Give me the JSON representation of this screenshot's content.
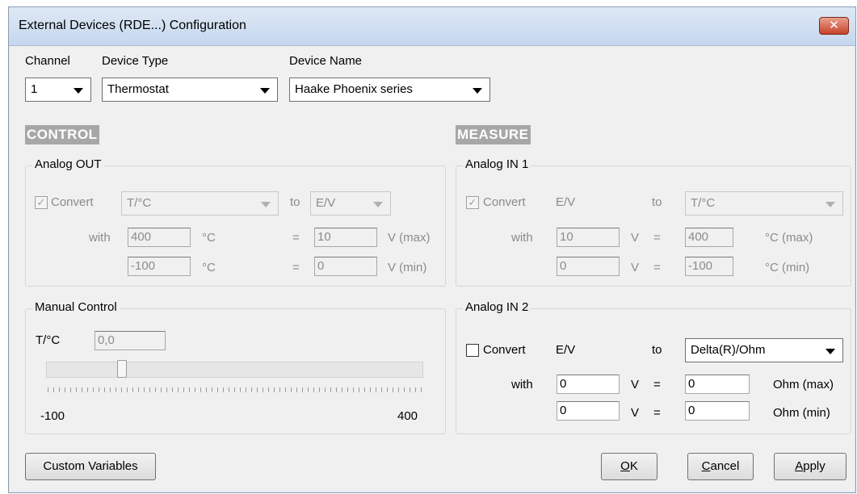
{
  "window": {
    "title": "External Devices (RDE...) Configuration",
    "close_glyph": "✕"
  },
  "header": {
    "channel_label": "Channel",
    "channel_value": "1",
    "device_type_label": "Device Type",
    "device_type_value": "Thermostat",
    "device_name_label": "Device Name",
    "device_name_value": "Haake Phoenix series"
  },
  "control": {
    "heading": "CONTROL",
    "analog_out": {
      "title": "Analog OUT",
      "convert_label": "Convert",
      "convert_checked": true,
      "from_value": "T/°C",
      "to_label": "to",
      "to_value": "E/V",
      "with_label": "with",
      "row1": {
        "left": "400",
        "left_unit": "°C",
        "eq": "=",
        "right": "10",
        "right_unit": "V (max)"
      },
      "row2": {
        "left": "-100",
        "left_unit": "°C",
        "eq": "=",
        "right": "0",
        "right_unit": "V (min)"
      }
    },
    "manual": {
      "title": "Manual Control",
      "t_label": "T/°C",
      "t_value": "0,0",
      "min_label": "-100",
      "max_label": "400",
      "slider_value": 0
    }
  },
  "measure": {
    "heading": "MEASURE",
    "analog_in1": {
      "title": "Analog IN 1",
      "convert_label": "Convert",
      "convert_checked": true,
      "from_value": "E/V",
      "to_label": "to",
      "to_value": "T/°C",
      "with_label": "with",
      "row1": {
        "left": "10",
        "left_unit": "V",
        "eq": "=",
        "right": "400",
        "right_unit": "°C (max)"
      },
      "row2": {
        "left": "0",
        "left_unit": "V",
        "eq": "=",
        "right": "-100",
        "right_unit": "°C (min)"
      }
    },
    "analog_in2": {
      "title": "Analog IN 2",
      "convert_label": "Convert",
      "convert_checked": false,
      "from_value": "E/V",
      "to_label": "to",
      "to_value": "Delta(R)/Ohm",
      "with_label": "with",
      "row1": {
        "left": "0",
        "left_unit": "V",
        "eq": "=",
        "right": "0",
        "right_unit": "Ohm (max)"
      },
      "row2": {
        "left": "0",
        "left_unit": "V",
        "eq": "=",
        "right": "0",
        "right_unit": "Ohm (min)"
      }
    }
  },
  "footer": {
    "custom_variables": "Custom Variables",
    "ok_accel": "O",
    "ok_rest": "K",
    "cancel_accel": "C",
    "cancel_rest": "ancel",
    "apply_accel": "A",
    "apply_rest": "pply"
  }
}
